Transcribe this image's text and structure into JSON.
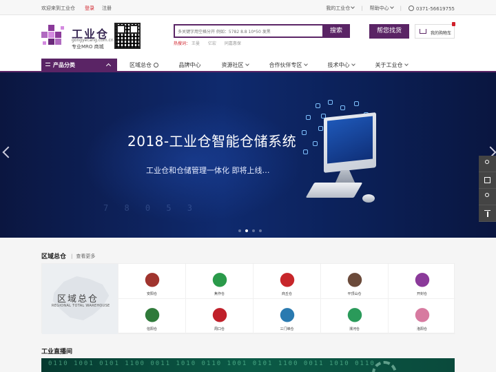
{
  "topbar": {
    "welcome": "欢迎来到工业仓",
    "login": "登录",
    "register": "注册",
    "my_account": "我的工业仓",
    "help_center": "帮助中心",
    "phone": "0371-56619755"
  },
  "header": {
    "logo_title": "工业仓",
    "logo_domain": "gongyecang.com.cn",
    "logo_slogan": "专业MRO 商城",
    "search_placeholder": "多关键字用空格分开 例如：5782 8.8 10*50 发黑",
    "search_button": "搜索",
    "hot_label": "热搜词：",
    "hot_words": [
      "王曼",
      "亿宏",
      "同嘉惠保"
    ],
    "find_button": "帮您找货",
    "cart_label": "我的购物车"
  },
  "nav": {
    "category_button": "产品分类",
    "items": [
      {
        "label": "区域总仓",
        "icon": "help-circle-icon"
      },
      {
        "label": "品牌中心"
      },
      {
        "label": "资源社区",
        "icon": "chevron-down-icon"
      },
      {
        "label": "合作伙伴专区",
        "icon": "chevron-down-icon"
      },
      {
        "label": "技术中心",
        "icon": "chevron-down-icon"
      },
      {
        "label": "关于工业仓",
        "icon": "chevron-down-icon"
      }
    ]
  },
  "banner": {
    "title": "2018-工业仓智能仓储系统",
    "subtitle": "工业仓和仓储管理一体化   即将上线…",
    "slide_count": 4,
    "active_slide": 1
  },
  "region": {
    "title": "区域总仓",
    "see_more": "查看更多",
    "map_title": "区域总仓",
    "map_subtitle": "REGIONAL TOTAL WAREHOUSE",
    "cities": [
      {
        "name": "安阳仓",
        "color": "#a0342e"
      },
      {
        "name": "焦作仓",
        "color": "#2a9a4a"
      },
      {
        "name": "商丘仓",
        "color": "#c7262a"
      },
      {
        "name": "平顶山仓",
        "color": "#6b4a3a"
      },
      {
        "name": "开封仓",
        "color": "#8b3a9a"
      },
      {
        "name": "信阳仓",
        "color": "#2f7a3a"
      },
      {
        "name": "周口仓",
        "color": "#c0202a"
      },
      {
        "name": "三门峡仓",
        "color": "#2a7ab0"
      },
      {
        "name": "漯河仓",
        "color": "#2a9a5a"
      },
      {
        "name": "洛阳仓",
        "color": "#d77aa0"
      }
    ]
  },
  "live": {
    "title": "工业直播间",
    "binary": "0110 1001 0101 1100 0011 1010 0110 1001 0101 1100 0011 1010 0110"
  }
}
